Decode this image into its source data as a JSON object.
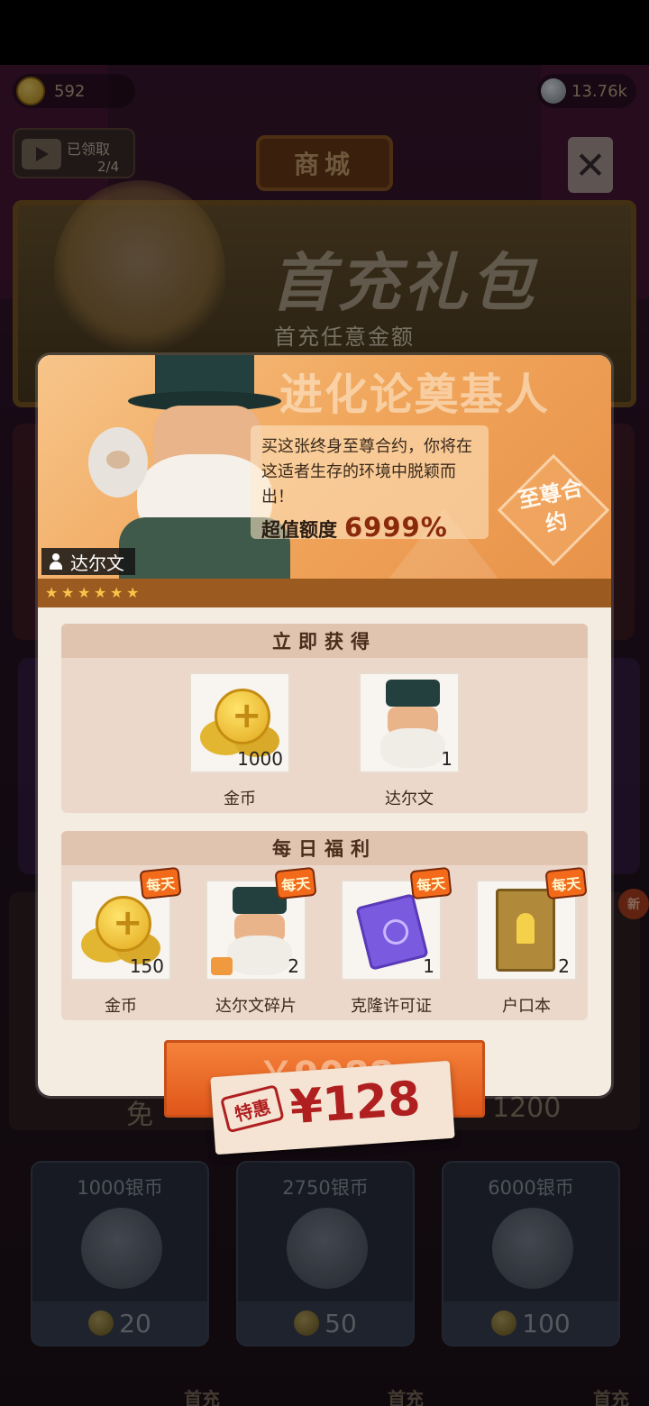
{
  "top_bar": {
    "gold_amount": "592",
    "silver_amount": "13.76k"
  },
  "ad_reward": {
    "label": "已领取",
    "count": "2/4"
  },
  "shop": {
    "title": "商城",
    "banner_title": "首充礼包",
    "banner_subtitle": "首充任意金额",
    "free_label": "免",
    "price_1200": "1200",
    "new_badge": "新"
  },
  "silver_packs": [
    {
      "title": "1000银币",
      "price": "20"
    },
    {
      "title": "2750银币",
      "price": "50"
    },
    {
      "title": "6000银币",
      "price": "100"
    }
  ],
  "first_purchase_tag": "首充",
  "modal": {
    "watermark": "进化论奠基人",
    "character_name": "达尔文",
    "description": "买这张终身至尊合约，你将在这适者生存的环境中脱颖而出！",
    "value_label": "超值额度",
    "value": "6999%",
    "badge_text": "至尊合约",
    "stars": 6,
    "section_instant": "立即获得",
    "instant_items": [
      {
        "name": "金币",
        "qty": "1000",
        "icon": "gold-coins-icon"
      },
      {
        "name": "达尔文",
        "qty": "1",
        "icon": "darwin-portrait-icon"
      }
    ],
    "section_daily": "每日福利",
    "daily_tag": "每天",
    "daily_items": [
      {
        "name": "金币",
        "qty": "150",
        "icon": "gold-coins-icon"
      },
      {
        "name": "达尔文碎片",
        "qty": "2",
        "icon": "darwin-fragment-icon"
      },
      {
        "name": "克隆许可证",
        "qty": "1",
        "icon": "clone-license-icon"
      },
      {
        "name": "户口本",
        "qty": "2",
        "icon": "household-book-icon"
      }
    ],
    "original_price": "￥9088",
    "sale_label": "特惠",
    "sale_price": "¥128"
  },
  "colors": {
    "accent_orange": "#e8924a",
    "price_red": "#b01f1f",
    "star_yellow": "#f7c44a"
  }
}
